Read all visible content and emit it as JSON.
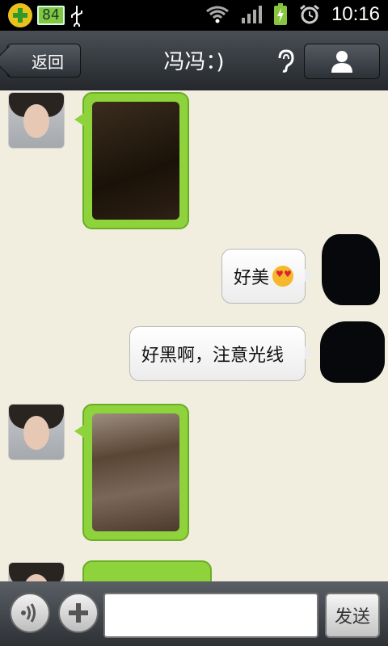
{
  "status_bar": {
    "battery_tag": "84",
    "time": "10:16"
  },
  "header": {
    "back_label": "返回",
    "title": "冯冯：)"
  },
  "messages": [
    {
      "side": "left",
      "type": "image"
    },
    {
      "side": "right",
      "type": "text",
      "text": "好美",
      "emoji": "heart-eyes-emoji"
    },
    {
      "side": "right",
      "type": "text",
      "text": "好黑啊，注意光线"
    },
    {
      "side": "left",
      "type": "image"
    },
    {
      "side": "left",
      "type": "image",
      "partial": true
    }
  ],
  "input_bar": {
    "placeholder": "",
    "send_label": "发送"
  },
  "colors": {
    "incoming_bubble": "#8ed23c",
    "chat_bg": "#f2eedf",
    "header_bg": "#2c3136"
  }
}
